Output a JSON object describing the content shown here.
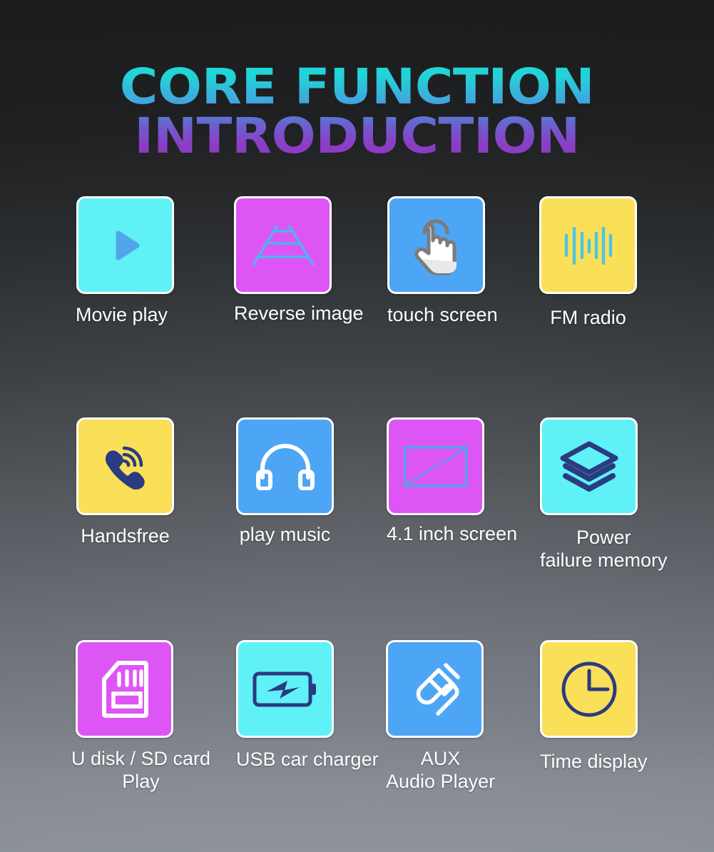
{
  "page": {
    "title": "CORE FUNCTION INTRODUCTION",
    "title_gradient_from": "#1fd9d4",
    "title_gradient_to": "#8e37c0",
    "label_color": "#ffffff",
    "background_top": "#1d1e20",
    "background_bottom": "#8e939b"
  },
  "palette": {
    "cyan": "#5ff1f6",
    "magenta": "#dd56f5",
    "blue": "#4da6f5",
    "yellow": "#fadf58",
    "navy": "#2a3b80",
    "icon_blue": "#54a5e8",
    "icon_white": "#ffffff"
  },
  "features": [
    {
      "id": "movie-play",
      "label": "Movie play",
      "icon": "play-icon",
      "tile_color": "#5ff1f6",
      "icon_color": "#54a5e8"
    },
    {
      "id": "reverse-image",
      "label": "Reverse image",
      "icon": "parking-lines-icon",
      "tile_color": "#dd56f5",
      "icon_color": "#4fb4ef"
    },
    {
      "id": "touch-screen",
      "label": "touch screen",
      "icon": "tap-hand-icon",
      "tile_color": "#4da6f5",
      "icon_color": "#ffffff"
    },
    {
      "id": "fm-radio",
      "label": "FM radio",
      "icon": "sound-wave-icon",
      "tile_color": "#fadf58",
      "icon_color": "#4fc3e0"
    },
    {
      "id": "handsfree",
      "label": "Handsfree",
      "icon": "phone-call-icon",
      "tile_color": "#fadf58",
      "icon_color": "#2a3b80"
    },
    {
      "id": "play-music",
      "label": "play music",
      "icon": "headphones-icon",
      "tile_color": "#4da6f5",
      "icon_color": "#ffffff"
    },
    {
      "id": "screen-size",
      "label": "4.1 inch screen",
      "icon": "screen-diagonal-icon",
      "tile_color": "#dd56f5",
      "icon_color": "#4fa6e8"
    },
    {
      "id": "power-memory",
      "label": "Power\nfailure memory",
      "icon": "layers-icon",
      "tile_color": "#5ff1f6",
      "icon_color": "#2a3b80"
    },
    {
      "id": "udisk-sdcard",
      "label": "U disk / SD card\nPlay",
      "icon": "sd-card-icon",
      "tile_color": "#dd56f5",
      "icon_color": "#ffffff"
    },
    {
      "id": "usb-car-charger",
      "label": "USB car charger",
      "icon": "battery-bolt-icon",
      "tile_color": "#5ff1f6",
      "icon_color": "#2a3b80"
    },
    {
      "id": "aux-audio-player",
      "label": "AUX\nAudio Player",
      "icon": "audio-jack-icon",
      "tile_color": "#4da6f5",
      "icon_color": "#ffffff"
    },
    {
      "id": "time-display",
      "label": "Time display",
      "icon": "clock-icon",
      "tile_color": "#fadf58",
      "icon_color": "#2a3b80"
    }
  ]
}
